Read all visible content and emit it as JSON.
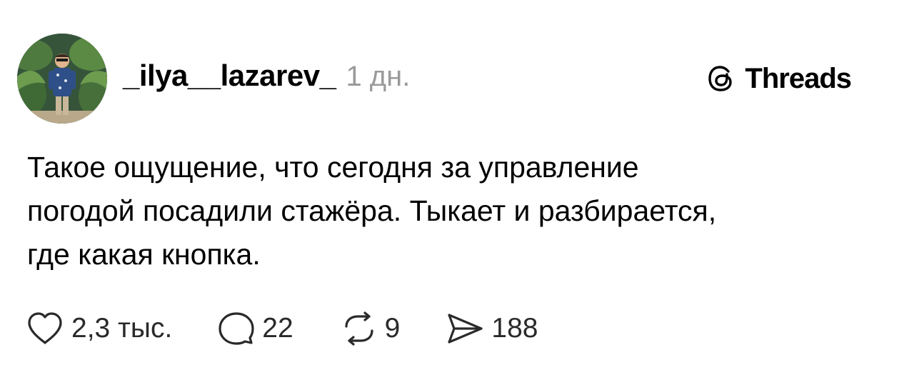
{
  "post": {
    "username": "_ilya__lazarev_",
    "time": "1 дн.",
    "lines": [
      "Такое ощущение, что сегодня за управление",
      "погодой посадили стажёра. Тыкает и разбирается,",
      "где какая кнопка."
    ]
  },
  "brand": {
    "name": "Threads",
    "icon": "threads-logo-icon"
  },
  "actions": {
    "likes": "2,3 тыс.",
    "replies": "22",
    "reposts": "9",
    "shares": "188",
    "icons": [
      "heart-icon",
      "comment-icon",
      "repost-icon",
      "share-icon"
    ]
  },
  "colors": {
    "text": "#000000",
    "muted": "#9a9a9a",
    "background": "#ffffff"
  }
}
